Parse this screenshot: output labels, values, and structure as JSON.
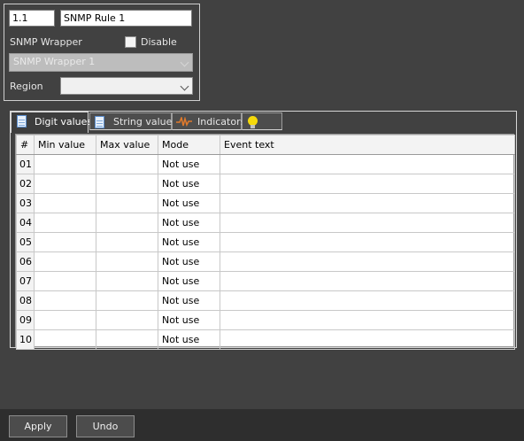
{
  "rule": {
    "id": "1.1",
    "name": "SNMP Rule 1"
  },
  "wrapper": {
    "label": "SNMP Wrapper",
    "disable_label": "Disable",
    "disable_checked": false,
    "selected": "SNMP Wrapper 1"
  },
  "region": {
    "label": "Region",
    "selected": ""
  },
  "tabs": [
    {
      "label": "Digit values",
      "icon": "document-icon",
      "active": true
    },
    {
      "label": "String values",
      "icon": "document-icon",
      "active": false
    },
    {
      "label": "Indicators",
      "icon": "waveform-icon",
      "active": false
    },
    {
      "label": "",
      "icon": "lightbulb-icon",
      "active": false
    }
  ],
  "grid": {
    "headers": [
      "#",
      "Min value",
      "Max value",
      "Mode",
      "Event text"
    ],
    "rows": [
      {
        "num": "01",
        "min": "",
        "max": "",
        "mode": "Not use",
        "event": ""
      },
      {
        "num": "02",
        "min": "",
        "max": "",
        "mode": "Not use",
        "event": ""
      },
      {
        "num": "03",
        "min": "",
        "max": "",
        "mode": "Not use",
        "event": ""
      },
      {
        "num": "04",
        "min": "",
        "max": "",
        "mode": "Not use",
        "event": ""
      },
      {
        "num": "05",
        "min": "",
        "max": "",
        "mode": "Not use",
        "event": ""
      },
      {
        "num": "06",
        "min": "",
        "max": "",
        "mode": "Not use",
        "event": ""
      },
      {
        "num": "07",
        "min": "",
        "max": "",
        "mode": "Not use",
        "event": ""
      },
      {
        "num": "08",
        "min": "",
        "max": "",
        "mode": "Not use",
        "event": ""
      },
      {
        "num": "09",
        "min": "",
        "max": "",
        "mode": "Not use",
        "event": ""
      },
      {
        "num": "10",
        "min": "",
        "max": "",
        "mode": "Not use",
        "event": ""
      }
    ]
  },
  "buttons": {
    "apply": "Apply",
    "undo": "Undo"
  },
  "colors": {
    "background": "#414141",
    "bottom_bar": "#2e2e2e",
    "bulb": "#f5d90a",
    "wave": "#e07a2c",
    "doc": "#5b8fd0"
  }
}
